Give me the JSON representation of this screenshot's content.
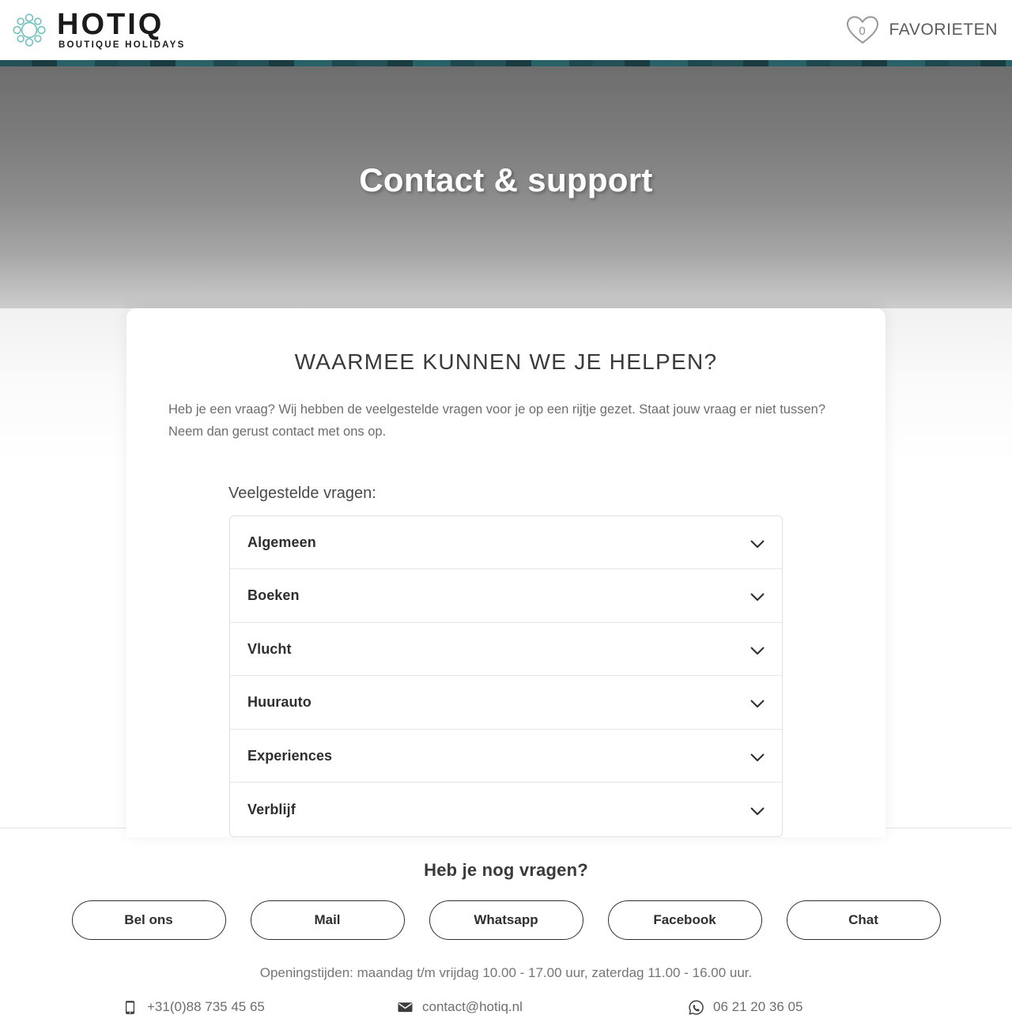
{
  "header": {
    "brand_name": "HOTIQ",
    "brand_tagline": "BOUTIQUE HOLIDAYS",
    "brand_mark_icon": "ornamental-circle-logo-icon",
    "favorites": {
      "icon": "heart-outline-icon",
      "count": "0",
      "label": "FAVORIETEN"
    },
    "accent_color": "#6fc2bd"
  },
  "hero": {
    "title": "Contact & support"
  },
  "card": {
    "heading": "WAARMEE KUNNEN WE JE HELPEN?",
    "intro": "Heb je een vraag? Wij hebben de veelgestelde vragen voor je op een rijtje gezet. Staat jouw vraag er niet tussen? Neem dan gerust contact met ons op.",
    "faq_label": "Veelgestelde vragen:",
    "faq_items": [
      {
        "label": "Algemeen",
        "icon": "chevron-down-icon"
      },
      {
        "label": "Boeken",
        "icon": "chevron-down-icon"
      },
      {
        "label": "Vlucht",
        "icon": "chevron-down-icon"
      },
      {
        "label": "Huurauto",
        "icon": "chevron-down-icon"
      },
      {
        "label": "Experiences",
        "icon": "chevron-down-icon"
      },
      {
        "label": "Verblijf",
        "icon": "chevron-down-icon"
      }
    ]
  },
  "footer": {
    "heading": "Heb je nog vragen?",
    "buttons": [
      {
        "label": "Bel ons"
      },
      {
        "label": "Mail"
      },
      {
        "label": "Whatsapp"
      },
      {
        "label": "Facebook"
      },
      {
        "label": "Chat"
      }
    ],
    "opening_hours": "Openingstijden: maandag t/m vrijdag 10.00 - 17.00 uur, zaterdag 11.00 - 16.00 uur.",
    "contacts": [
      {
        "icon": "mobile-phone-icon",
        "value": "+31(0)88 735 45 65"
      },
      {
        "icon": "envelope-icon",
        "value": "contact@hotiq.nl"
      },
      {
        "icon": "whatsapp-icon",
        "value": "06 21 20 36 05"
      }
    ]
  }
}
